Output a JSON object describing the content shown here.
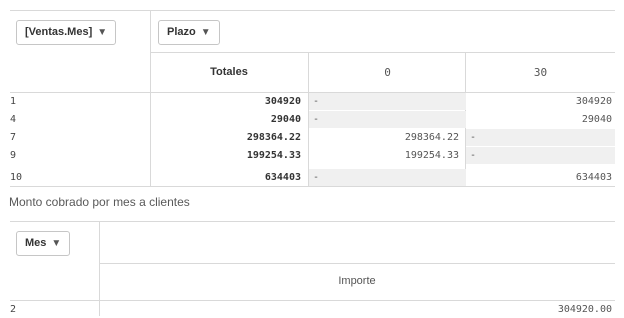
{
  "table1": {
    "row_dimension_label": "[Ventas.Mes]",
    "column_dimension_label": "Plazo",
    "totals_header": "Totales",
    "columns": [
      "0",
      "30"
    ],
    "rows": [
      {
        "dim": "1",
        "total": "304920",
        "c0": "-",
        "c30": "304920"
      },
      {
        "dim": "4",
        "total": "29040",
        "c0": "-",
        "c30": "29040"
      },
      {
        "dim": "7",
        "total": "298364.22",
        "c0": "298364.22",
        "c30": "-"
      },
      {
        "dim": "9",
        "total": "199254.33",
        "c0": "199254.33",
        "c30": "-"
      },
      {
        "dim": "10",
        "total": "634403",
        "c0": "-",
        "c30": "634403"
      }
    ]
  },
  "section_caption": "Monto cobrado por mes a clientes",
  "table2": {
    "row_dimension_label": "Mes",
    "measure_header": "Importe",
    "rows": [
      {
        "dim": "2",
        "value": "304920.00"
      }
    ]
  }
}
